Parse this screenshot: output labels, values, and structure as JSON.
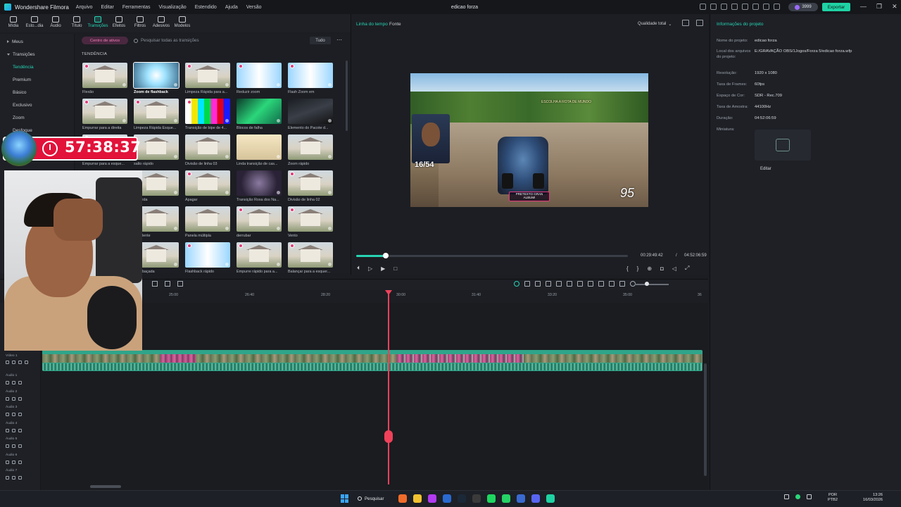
{
  "app": {
    "name": "Wondershare Filmora",
    "project_title": "edicao forza",
    "menu": [
      "Arquivo",
      "Editar",
      "Ferramentas",
      "Visualização",
      "Estendido",
      "Ajuda",
      "Versão"
    ],
    "credits": "3999",
    "export_label": "Exportar",
    "window_controls": [
      "—",
      "❐",
      "✕"
    ]
  },
  "toolbar": {
    "items": [
      {
        "label": "Mídia",
        "icon": "media-icon"
      },
      {
        "label": "Esto...dia",
        "icon": "stock-media-icon"
      },
      {
        "label": "Áudio",
        "icon": "audio-icon"
      },
      {
        "label": "Título",
        "icon": "title-icon"
      },
      {
        "label": "Transições",
        "icon": "transitions-icon",
        "active": true
      },
      {
        "label": "Efeitos",
        "icon": "effects-icon"
      },
      {
        "label": "Filtros",
        "icon": "filters-icon"
      },
      {
        "label": "Adesivos",
        "icon": "stickers-icon"
      },
      {
        "label": "Modelos",
        "icon": "templates-icon"
      }
    ]
  },
  "categories": {
    "mine": "Meus",
    "transitions": "Transições",
    "items": [
      "Tendência",
      "Premium",
      "Básico",
      "Exclusivo",
      "Zoom",
      "Desfoque"
    ]
  },
  "browser": {
    "asset_center": "Centro de ativos",
    "search_placeholder": "Pesquisar todas as transições",
    "filter": "Tudo",
    "more": "⋯",
    "section": "TENDÊNCIA",
    "thumbnails": [
      "Flexão",
      "Zoom de flashback",
      "Limpeza Rápida para a...",
      "Reduzir zoom",
      "Flash Zoom em",
      "Empurrar para a direita",
      "Limpeza Rápida Esque...",
      "Transição de bipe de 4...",
      "Blocos de falha",
      "Elemento do Pacote d...",
      "Empurrar para a esque...",
      "salto rápido",
      "Divisão de linha 03",
      "Linda transição de cas...",
      "Zoom rápido",
      "...rápida",
      "Apagar",
      "Transição Roxa dos Na...",
      "Divisão de linha 02",
      "...da lente",
      "Panela múltipla",
      "derrubar",
      "Vento",
      "...embaçada",
      "Flashback rápido",
      "Empurre rápido para a...",
      "Balançar para a esquer..."
    ]
  },
  "player": {
    "tab_timeline": "Linha do tempo",
    "tab_source": "Fonte",
    "quality": "Qualidade total",
    "progress": 0.109,
    "current_time": "00:29:49:42",
    "separator": "/",
    "total_time": "04:52:06:59",
    "hud": {
      "position": "16/54",
      "speed": "95",
      "top_text": "ESCOLHA A ROTA DE MUNDO",
      "bottom_text": "PRETEXTO GRAN ALBUM!"
    }
  },
  "project_info": {
    "title": "Informações do projeto",
    "fields": [
      {
        "label": "Nome do projeto:",
        "value": "edicao forza"
      },
      {
        "label": "Local dos arquivos do projeto:",
        "value": "E:/GRAVAÇÃO OBS/1Jogos/Forza 5/edicao forza.wfp"
      },
      {
        "label": "Resolução:",
        "value": "1920 x 1080"
      },
      {
        "label": "Taxa de Frames:",
        "value": "60fps"
      },
      {
        "label": "Espaço de Cor:",
        "value": "SDR - Rec.709"
      },
      {
        "label": "Taxa de Amostra:",
        "value": "44100Hz"
      },
      {
        "label": "Duração:",
        "value": "04:52:06:59"
      },
      {
        "label": "Miniatura:",
        "value": ""
      }
    ],
    "edit_label": "Editar"
  },
  "timeline": {
    "ruler": [
      "25:00",
      "26:40",
      "28:20",
      "30:00",
      "31:40",
      "33:20",
      "35:00",
      "36"
    ],
    "tracks": [
      "Vídeo 1",
      "Áudio 1",
      "Áudio 2",
      "Áudio 3",
      "Áudio 4",
      "Áudio 5",
      "Áudio 6",
      "Áudio 7"
    ]
  },
  "overlay": {
    "timer": "57:38:37"
  },
  "taskbar": {
    "search": "Pesquisar",
    "lang_line1": "POR",
    "lang_line2": "PTB2",
    "time": "13:26",
    "date": "16/03/2026"
  },
  "colors": {
    "accent": "#27d3b3",
    "export": "#1fd2a4",
    "playhead": "#f0415a",
    "timer_bg": "#e2123a"
  }
}
